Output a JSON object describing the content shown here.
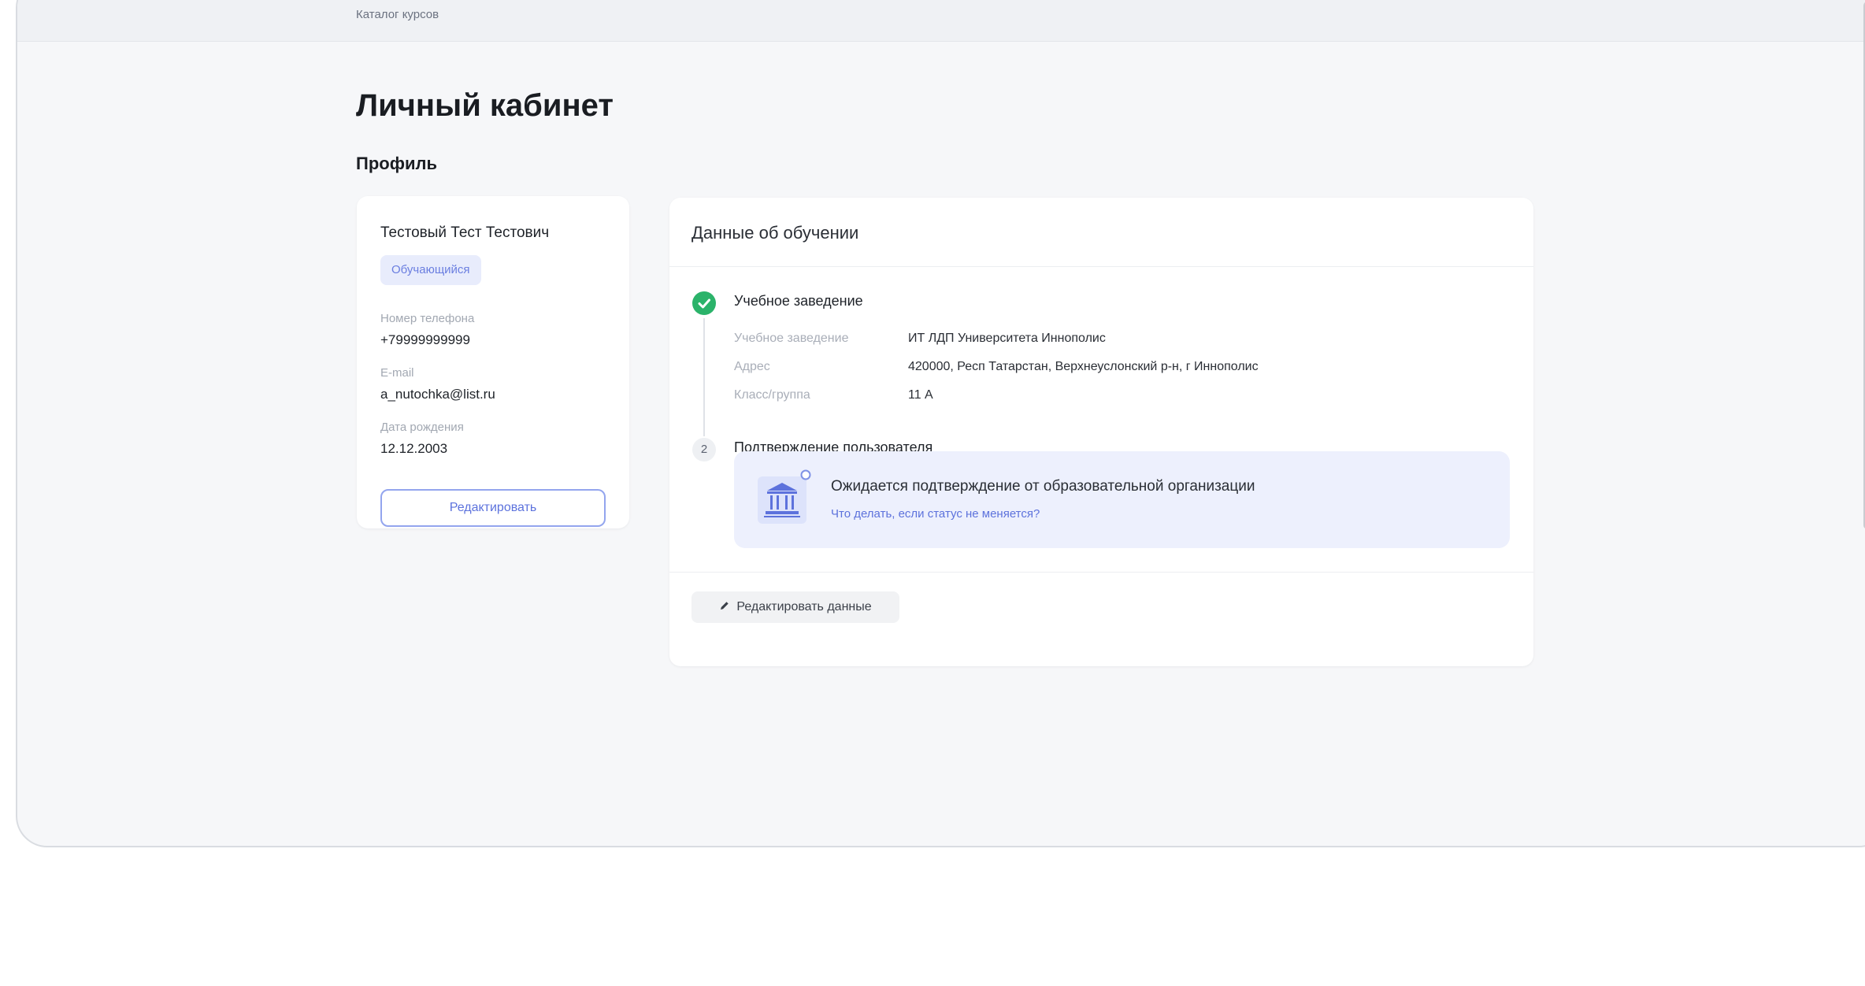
{
  "header": {
    "breadcrumb": "Каталог курсов"
  },
  "page": {
    "title": "Личный кабинет",
    "section": "Профиль"
  },
  "profile": {
    "name": "Тестовый Тест Тестович",
    "role": "Обучающийся",
    "fields": [
      {
        "label": "Номер телефона",
        "value": "+79999999999"
      },
      {
        "label": "E-mail",
        "value": "a_nutochka@list.ru"
      },
      {
        "label": "Дата рождения",
        "value": "12.12.2003"
      }
    ],
    "edit_label": "Редактировать"
  },
  "study": {
    "title": "Данные об обучении",
    "step1": {
      "title": "Учебное заведение",
      "rows": [
        {
          "label": "Учебное заведение",
          "value": "ИТ ЛДП Университета Иннополис"
        },
        {
          "label": "Адрес",
          "value": "420000, Респ Татарстан, Верхнеуслонский р-н, г Иннополис"
        },
        {
          "label": "Класс/группа",
          "value": "11 А"
        }
      ]
    },
    "step2": {
      "number": "2",
      "title": "Подтверждение пользователя"
    },
    "notice": {
      "title": "Ожидается подтверждение от образовательной организации",
      "link": "Что делать, если статус не меняется?",
      "icon": "bank-building-icon"
    },
    "edit_data_label": "Редактировать данные",
    "edit_data_icon": "pencil-icon"
  },
  "colors": {
    "accent": "#5d72dc",
    "success": "#2bb36a",
    "badge_bg": "#e8ecfc",
    "notice_bg": "#edf0fd"
  }
}
